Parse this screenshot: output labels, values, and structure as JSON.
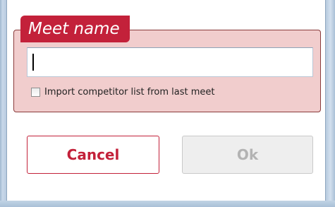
{
  "dialog": {
    "group_title": "Meet name",
    "meet_name_value": "",
    "import_checkbox_label": "Import competitor list from last meet",
    "import_checkbox_checked": false,
    "cancel_label": "Cancel",
    "ok_label": "Ok",
    "ok_enabled": false
  },
  "colors": {
    "accent": "#c3213a",
    "group_background": "#f1cdcd",
    "disabled_text": "#b3b3b3"
  }
}
